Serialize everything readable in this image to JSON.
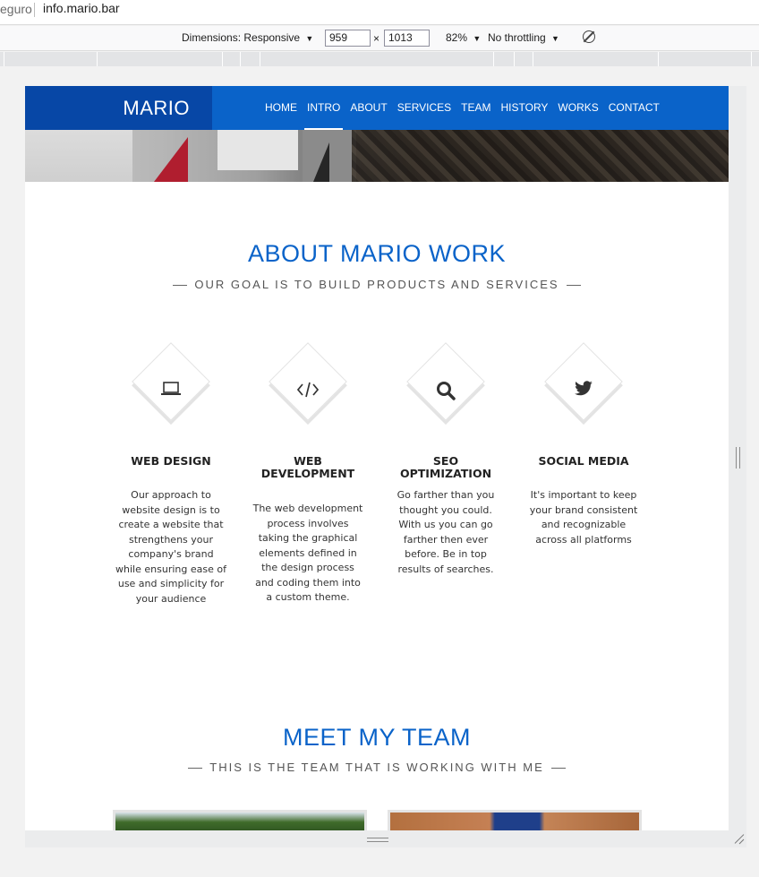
{
  "browser": {
    "secure_label": "eguro",
    "url": "info.mario.bar"
  },
  "toolbar": {
    "dimensions_label": "Dimensions: Responsive",
    "width_value": "959",
    "times": "×",
    "height_value": "1013",
    "zoom": "82%",
    "throttling": "No throttling",
    "dropdown_arrow": "▼"
  },
  "site": {
    "brand": "MARIO",
    "menu": [
      {
        "label": "HOME",
        "active": false
      },
      {
        "label": "INTRO",
        "active": true
      },
      {
        "label": "ABOUT",
        "active": false
      },
      {
        "label": "SERVICES",
        "active": false
      },
      {
        "label": "TEAM",
        "active": false
      },
      {
        "label": "HISTORY",
        "active": false
      },
      {
        "label": "WORKS",
        "active": false
      },
      {
        "label": "CONTACT",
        "active": false
      }
    ],
    "accent_color": "#0a63c9",
    "brand_bg_color": "#0747a6"
  },
  "about": {
    "title": "ABOUT MARIO WORK",
    "subtitle": "OUR GOAL IS TO BUILD PRODUCTS AND SERVICES",
    "services": [
      {
        "icon": "laptop-icon",
        "title": "WEB DESIGN",
        "text": "Our approach to website design is to create a website that strengthens your company's brand while ensuring ease of use and simplicity for your audience"
      },
      {
        "icon": "code-icon",
        "title": "WEB DEVELOPMENT",
        "text": "The web development process involves taking the graphical elements defined in the design process and coding them into a custom theme."
      },
      {
        "icon": "search-icon",
        "title": "SEO OPTIMIZATION",
        "text": "Go farther than you thought you could. With us you can go farther then ever before. Be in top results of searches."
      },
      {
        "icon": "twitter-icon",
        "title": "SOCIAL MEDIA",
        "text": "It's important to keep your brand consistent and recognizable across all platforms"
      }
    ]
  },
  "team": {
    "title": "MEET MY TEAM",
    "subtitle": "THIS IS THE TEAM THAT IS WORKING WITH ME"
  }
}
